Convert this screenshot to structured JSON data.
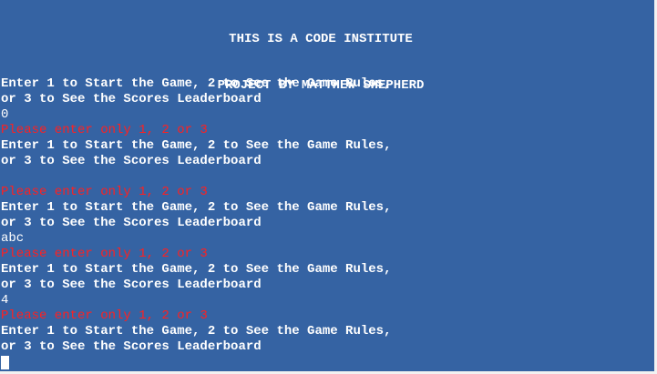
{
  "header": {
    "line1": "THIS IS A CODE INSTITUTE",
    "line2": "PROJECT BY MATTHEW SHEPHERD"
  },
  "menu": {
    "prompt_line1": "Enter 1 to Start the Game, 2 to See the Game Rules,",
    "prompt_line2": "or 3 to See the Scores Leaderboard",
    "error": "Please enter only 1, 2 or 3"
  },
  "inputs": [
    "0",
    "",
    "abc",
    "4"
  ],
  "colors": {
    "background": "#3563a3",
    "text": "#ffffff",
    "error": "#ff2020"
  }
}
